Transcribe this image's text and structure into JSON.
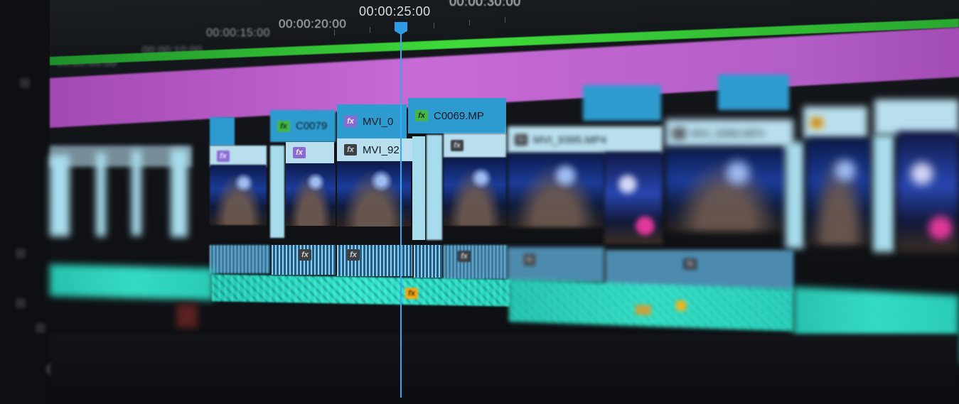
{
  "timecodes": {
    "t0": "00:00:15:00",
    "t1": "00:00:20:00",
    "t2": "00:00:25:00",
    "t3": "00:00:30:00"
  },
  "ruler_left_labels": [
    "00:00:05:00",
    "00:00:10:00"
  ],
  "clips": {
    "video_top": [
      {
        "label": "C0079",
        "badge": "fx-green"
      },
      {
        "label": "MVI_0",
        "badge": "fx"
      },
      {
        "label": "C0069.MP",
        "badge": "fx"
      }
    ],
    "video_mid": [
      {
        "label": "MVI_92",
        "badge": "fx"
      },
      {
        "label": "MVI_9395.MP4",
        "badge": "fx"
      },
      {
        "label": "MVI_9396.MP4",
        "badge": "fx"
      }
    ]
  },
  "fx_text": "fx",
  "colors": {
    "playhead": "#3aa7f2",
    "work_area": "#3fdc3a",
    "adjustment_layer": "#c86bd6",
    "video_clip": "#2e9bd0",
    "audio_clip": "#30e6cd"
  },
  "icons": {
    "playhead": "playhead-icon",
    "fx_badge": "fx-badge-icon"
  }
}
